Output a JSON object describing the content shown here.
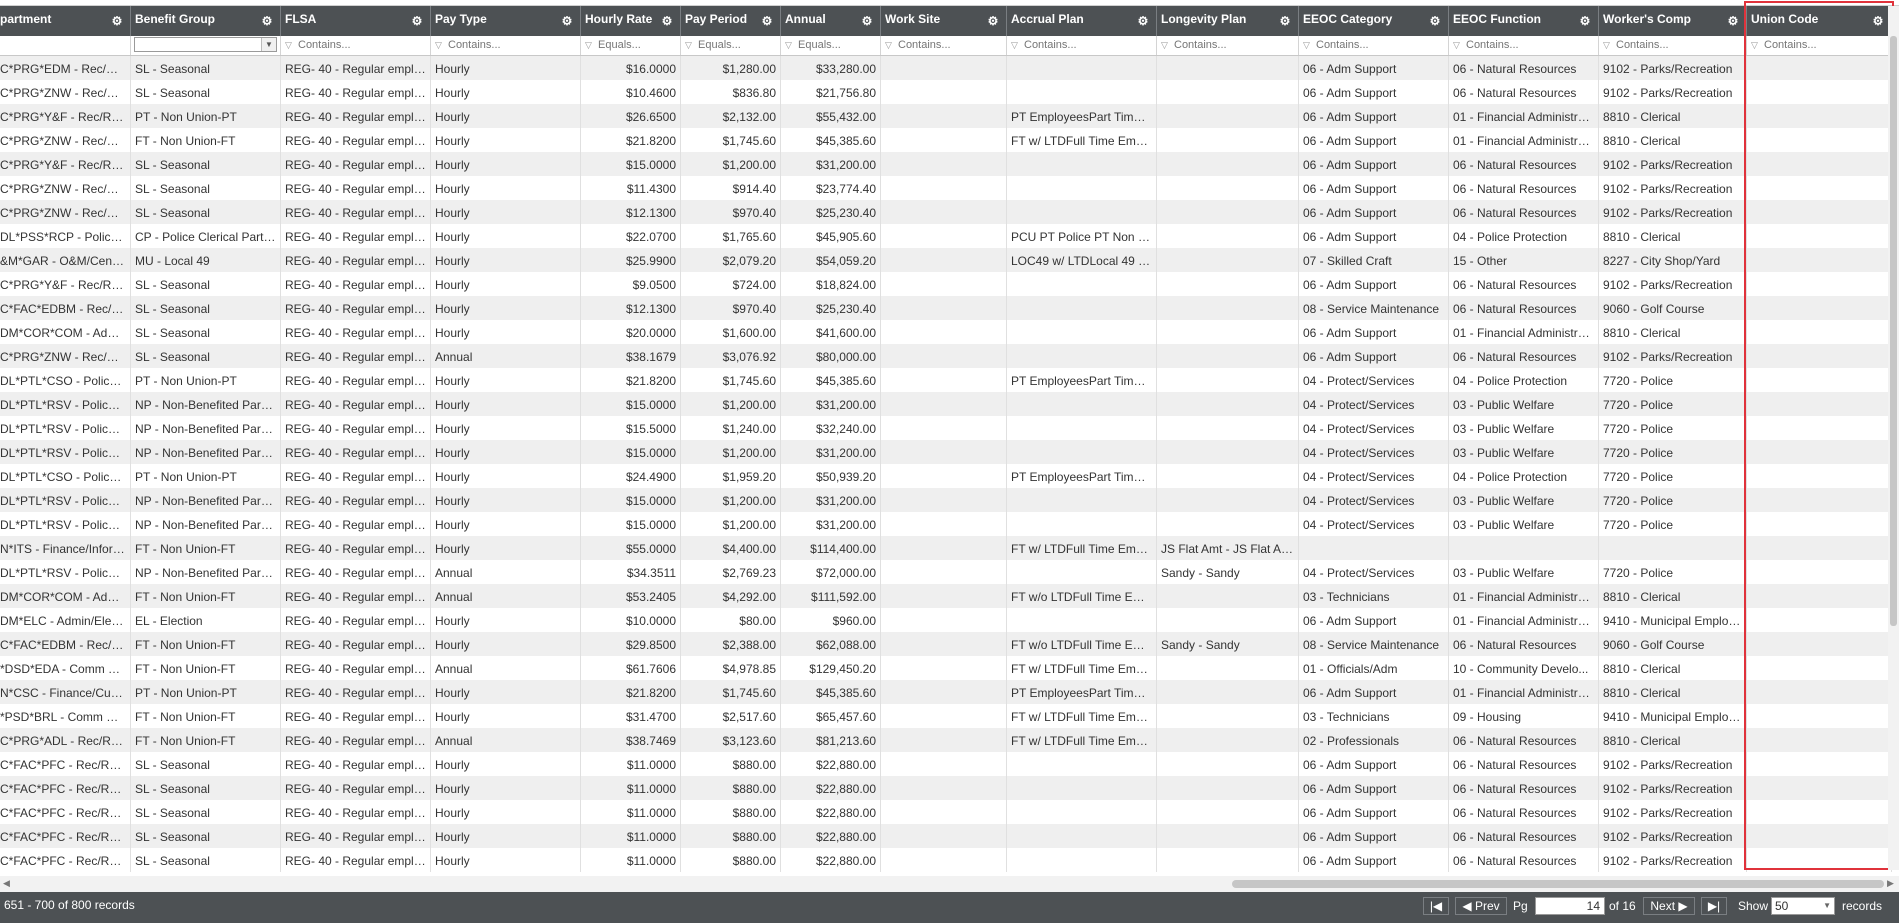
{
  "columns": [
    {
      "label": "partment",
      "filter": ""
    },
    {
      "label": "Benefit Group",
      "filter": "combo"
    },
    {
      "label": "FLSA",
      "filter": "Contains..."
    },
    {
      "label": "Pay Type",
      "filter": "Contains..."
    },
    {
      "label": "Hourly Rate",
      "filter": "Equals..."
    },
    {
      "label": "Pay Period",
      "filter": "Equals..."
    },
    {
      "label": "Annual",
      "filter": "Equals..."
    },
    {
      "label": "Work Site",
      "filter": "Contains..."
    },
    {
      "label": "Accrual Plan",
      "filter": "Contains..."
    },
    {
      "label": "Longevity Plan",
      "filter": "Contains..."
    },
    {
      "label": "EEOC Category",
      "filter": "Contains..."
    },
    {
      "label": "EEOC Function",
      "filter": "Contains..."
    },
    {
      "label": "Worker's Comp",
      "filter": "Contains..."
    },
    {
      "label": "Union Code",
      "filter": "Contains..."
    }
  ],
  "rows": [
    [
      "C*PRG*EDM - Rec/Rec...",
      "SL - Seasonal",
      "REG- 40 - Regular emplo...",
      "Hourly",
      "$16.0000",
      "$1,280.00",
      "$33,280.00",
      "",
      "",
      "",
      "06 - Adm Support",
      "06 - Natural Resources",
      "9102 - Parks/Recreation",
      ""
    ],
    [
      "C*PRG*ZNW - Rec/Re...",
      "SL - Seasonal",
      "REG- 40 - Regular emplo...",
      "Hourly",
      "$10.4600",
      "$836.80",
      "$21,756.80",
      "",
      "",
      "",
      "06 - Adm Support",
      "06 - Natural Resources",
      "9102 - Parks/Recreation",
      ""
    ],
    [
      "C*PRG*Y&F - Rec/Rec...",
      "PT - Non Union-PT",
      "REG- 40 - Regular emplo...",
      "Hourly",
      "$26.6500",
      "$2,132.00",
      "$55,432.00",
      "",
      "PT EmployeesPart Time ...",
      "",
      "06 - Adm Support",
      "01 - Financial Administra...",
      "8810 - Clerical",
      ""
    ],
    [
      "C*PRG*ZNW - Rec/Re...",
      "FT - Non Union-FT",
      "REG- 40 - Regular emplo...",
      "Hourly",
      "$21.8200",
      "$1,745.60",
      "$45,385.60",
      "",
      "FT w/ LTDFull Time Empl...",
      "",
      "06 - Adm Support",
      "01 - Financial Administra...",
      "8810 - Clerical",
      ""
    ],
    [
      "C*PRG*Y&F - Rec/Rec...",
      "SL - Seasonal",
      "REG- 40 - Regular emplo...",
      "Hourly",
      "$15.0000",
      "$1,200.00",
      "$31,200.00",
      "",
      "",
      "",
      "06 - Adm Support",
      "06 - Natural Resources",
      "9102 - Parks/Recreation",
      ""
    ],
    [
      "C*PRG*ZNW - Rec/Re...",
      "SL - Seasonal",
      "REG- 40 - Regular emplo...",
      "Hourly",
      "$11.4300",
      "$914.40",
      "$23,774.40",
      "",
      "",
      "",
      "06 - Adm Support",
      "06 - Natural Resources",
      "9102 - Parks/Recreation",
      ""
    ],
    [
      "C*PRG*ZNW - Rec/Re...",
      "SL - Seasonal",
      "REG- 40 - Regular emplo...",
      "Hourly",
      "$12.1300",
      "$970.40",
      "$25,230.40",
      "",
      "",
      "",
      "06 - Adm Support",
      "06 - Natural Resources",
      "9102 - Parks/Recreation",
      ""
    ],
    [
      "DL*PSS*RCP - Police/P...",
      "CP - Police Clerical Part T...",
      "REG- 40 - Regular emplo...",
      "Hourly",
      "$22.0700",
      "$1,765.60",
      "$45,905.60",
      "",
      "PCU PT Police PT Non Su...",
      "",
      "06 - Adm Support",
      "04 - Police Protection",
      "8810 - Clerical",
      ""
    ],
    [
      "&M*GAR - O&M/Centr...",
      "MU - Local 49",
      "REG- 40 - Regular emplo...",
      "Hourly",
      "$25.9900",
      "$2,079.20",
      "$54,059.20",
      "",
      "LOC49 w/ LTDLocal 49 E...",
      "",
      "07 - Skilled Craft",
      "15 - Other",
      "8227 - City Shop/Yard",
      ""
    ],
    [
      "C*PRG*Y&F - Rec/Rec...",
      "SL - Seasonal",
      "REG- 40 - Regular emplo...",
      "Hourly",
      "$9.0500",
      "$724.00",
      "$18,824.00",
      "",
      "",
      "",
      "06 - Adm Support",
      "06 - Natural Resources",
      "9102 - Parks/Recreation",
      ""
    ],
    [
      "C*FAC*EDBM - Rec/Re...",
      "SL - Seasonal",
      "REG- 40 - Regular emplo...",
      "Hourly",
      "$12.1300",
      "$970.40",
      "$25,230.40",
      "",
      "",
      "",
      "08 - Service Maintenance",
      "06 - Natural Resources",
      "9060 - Golf Course",
      ""
    ],
    [
      "DM*COR*COM - Admi...",
      "SL - Seasonal",
      "REG- 40 - Regular emplo...",
      "Hourly",
      "$20.0000",
      "$1,600.00",
      "$41,600.00",
      "",
      "",
      "",
      "06 - Adm Support",
      "01 - Financial Administra...",
      "8810 - Clerical",
      ""
    ],
    [
      "C*PRG*ZNW - Rec/Re...",
      "SL - Seasonal",
      "REG- 40 - Regular emplo...",
      "Annual",
      "$38.1679",
      "$3,076.92",
      "$80,000.00",
      "",
      "",
      "",
      "06 - Adm Support",
      "06 - Natural Resources",
      "9102 - Parks/Recreation",
      ""
    ],
    [
      "DL*PTL*CSO - Police/P...",
      "PT - Non Union-PT",
      "REG- 40 - Regular emplo...",
      "Hourly",
      "$21.8200",
      "$1,745.60",
      "$45,385.60",
      "",
      "PT EmployeesPart Time ...",
      "",
      "04 - Protect/Services",
      "04 - Police Protection",
      "7720 - Police",
      ""
    ],
    [
      "DL*PTL*RSV - Police/Pa...",
      "NP - Non-Benefited Part ...",
      "REG- 40 - Regular emplo...",
      "Hourly",
      "$15.0000",
      "$1,200.00",
      "$31,200.00",
      "",
      "",
      "",
      "04 - Protect/Services",
      "03 - Public Welfare",
      "7720 - Police",
      ""
    ],
    [
      "DL*PTL*RSV - Police/Pa...",
      "NP - Non-Benefited Part ...",
      "REG- 40 - Regular emplo...",
      "Hourly",
      "$15.5000",
      "$1,240.00",
      "$32,240.00",
      "",
      "",
      "",
      "04 - Protect/Services",
      "03 - Public Welfare",
      "7720 - Police",
      ""
    ],
    [
      "DL*PTL*RSV - Police/Pa...",
      "NP - Non-Benefited Part ...",
      "REG- 40 - Regular emplo...",
      "Hourly",
      "$15.0000",
      "$1,200.00",
      "$31,200.00",
      "",
      "",
      "",
      "04 - Protect/Services",
      "03 - Public Welfare",
      "7720 - Police",
      ""
    ],
    [
      "DL*PTL*CSO - Police/P...",
      "PT - Non Union-PT",
      "REG- 40 - Regular emplo...",
      "Hourly",
      "$24.4900",
      "$1,959.20",
      "$50,939.20",
      "",
      "PT EmployeesPart Time ...",
      "",
      "04 - Protect/Services",
      "04 - Police Protection",
      "7720 - Police",
      ""
    ],
    [
      "DL*PTL*RSV - Police/Pa...",
      "NP - Non-Benefited Part ...",
      "REG- 40 - Regular emplo...",
      "Hourly",
      "$15.0000",
      "$1,200.00",
      "$31,200.00",
      "",
      "",
      "",
      "04 - Protect/Services",
      "03 - Public Welfare",
      "7720 - Police",
      ""
    ],
    [
      "DL*PTL*RSV - Police/Pa...",
      "NP - Non-Benefited Part ...",
      "REG- 40 - Regular emplo...",
      "Hourly",
      "$15.0000",
      "$1,200.00",
      "$31,200.00",
      "",
      "",
      "",
      "04 - Protect/Services",
      "03 - Public Welfare",
      "7720 - Police",
      ""
    ],
    [
      "N*ITS - Finance/Inform...",
      "FT - Non Union-FT",
      "REG- 40 - Regular emplo...",
      "Hourly",
      "$55.0000",
      "$4,400.00",
      "$114,400.00",
      "",
      "FT w/ LTDFull Time Empl...",
      "JS Flat Amt - JS Flat Amt",
      "",
      "",
      "",
      ""
    ],
    [
      "DL*PTL*RSV - Police/Pa...",
      "NP - Non-Benefited Part ...",
      "REG- 40 - Regular emplo...",
      "Annual",
      "$34.3511",
      "$2,769.23",
      "$72,000.00",
      "",
      "",
      "Sandy - Sandy",
      "04 - Protect/Services",
      "03 - Public Welfare",
      "7720 - Police",
      ""
    ],
    [
      "DM*COR*COM - Admi...",
      "FT - Non Union-FT",
      "REG- 40 - Regular emplo...",
      "Annual",
      "$53.2405",
      "$4,292.00",
      "$111,592.00",
      "",
      "FT w/o LTDFull Time Em...",
      "",
      "03 - Technicians",
      "01 - Financial Administra...",
      "8810 - Clerical",
      ""
    ],
    [
      "DM*ELC - Admin/Electi...",
      "EL - Election",
      "REG- 40 - Regular emplo...",
      "Hourly",
      "$10.0000",
      "$80.00",
      "$960.00",
      "",
      "",
      "",
      "06 - Adm Support",
      "01 - Financial Administra...",
      "9410 - Municipal Employ...",
      ""
    ],
    [
      "C*FAC*EDBM - Rec/Re...",
      "FT - Non Union-FT",
      "REG- 40 - Regular emplo...",
      "Hourly",
      "$29.8500",
      "$2,388.00",
      "$62,088.00",
      "",
      "FT w/o LTDFull Time Em...",
      "Sandy - Sandy",
      "08 - Service Maintenance",
      "06 - Natural Resources",
      "9060 - Golf Course",
      ""
    ],
    [
      "*DSD*EDA - Comm D...",
      "FT - Non Union-FT",
      "REG- 40 - Regular emplo...",
      "Annual",
      "$61.7606",
      "$4,978.85",
      "$129,450.20",
      "",
      "FT w/ LTDFull Time Empl...",
      "",
      "01 - Officials/Adm",
      "10 - Community Develo...",
      "8810 - Clerical",
      ""
    ],
    [
      "N*CSC - Finance/Custo...",
      "PT - Non Union-PT",
      "REG- 40 - Regular emplo...",
      "Hourly",
      "$21.8200",
      "$1,745.60",
      "$45,385.60",
      "",
      "PT EmployeesPart Time ...",
      "",
      "06 - Adm Support",
      "01 - Financial Administra...",
      "8810 - Clerical",
      ""
    ],
    [
      "*PSD*BRL - Comm De...",
      "FT - Non Union-FT",
      "REG- 40 - Regular emplo...",
      "Hourly",
      "$31.4700",
      "$2,517.60",
      "$65,457.60",
      "",
      "FT w/ LTDFull Time Empl...",
      "",
      "03 - Technicians",
      "09 - Housing",
      "9410 - Municipal Employ...",
      ""
    ],
    [
      "C*PRG*ADL - Rec/Recr...",
      "FT - Non Union-FT",
      "REG- 40 - Regular emplo...",
      "Annual",
      "$38.7469",
      "$3,123.60",
      "$81,213.60",
      "",
      "FT w/ LTDFull Time Empl...",
      "",
      "02 - Professionals",
      "06 - Natural Resources",
      "8810 - Clerical",
      ""
    ],
    [
      "C*FAC*PFC - Rec/Recr...",
      "SL - Seasonal",
      "REG- 40 - Regular emplo...",
      "Hourly",
      "$11.0000",
      "$880.00",
      "$22,880.00",
      "",
      "",
      "",
      "06 - Adm Support",
      "06 - Natural Resources",
      "9102 - Parks/Recreation",
      ""
    ],
    [
      "C*FAC*PFC - Rec/Recr...",
      "SL - Seasonal",
      "REG- 40 - Regular emplo...",
      "Hourly",
      "$11.0000",
      "$880.00",
      "$22,880.00",
      "",
      "",
      "",
      "06 - Adm Support",
      "06 - Natural Resources",
      "9102 - Parks/Recreation",
      ""
    ],
    [
      "C*FAC*PFC - Rec/Recr...",
      "SL - Seasonal",
      "REG- 40 - Regular emplo...",
      "Hourly",
      "$11.0000",
      "$880.00",
      "$22,880.00",
      "",
      "",
      "",
      "06 - Adm Support",
      "06 - Natural Resources",
      "9102 - Parks/Recreation",
      ""
    ],
    [
      "C*FAC*PFC - Rec/Recr...",
      "SL - Seasonal",
      "REG- 40 - Regular emplo...",
      "Hourly",
      "$11.0000",
      "$880.00",
      "$22,880.00",
      "",
      "",
      "",
      "06 - Adm Support",
      "06 - Natural Resources",
      "9102 - Parks/Recreation",
      ""
    ],
    [
      "C*FAC*PFC - Rec/Recr...",
      "SL - Seasonal",
      "REG- 40 - Regular emplo...",
      "Hourly",
      "$11.0000",
      "$880.00",
      "$22,880.00",
      "",
      "",
      "",
      "06 - Adm Support",
      "06 - Natural Resources",
      "9102 - Parks/Recreation",
      ""
    ]
  ],
  "pager": {
    "records_text": "651 - 700 of 800 records",
    "prev_label": "Prev",
    "pg_label": "Pg",
    "page_value": "14",
    "of_label": "of 16",
    "next_label": "Next",
    "show_label": "Show",
    "show_value": "50",
    "records_label": "records"
  },
  "colors": {
    "header_bg": "#4d5154",
    "highlight": "#e0323b",
    "alt_row": "#efefef"
  }
}
